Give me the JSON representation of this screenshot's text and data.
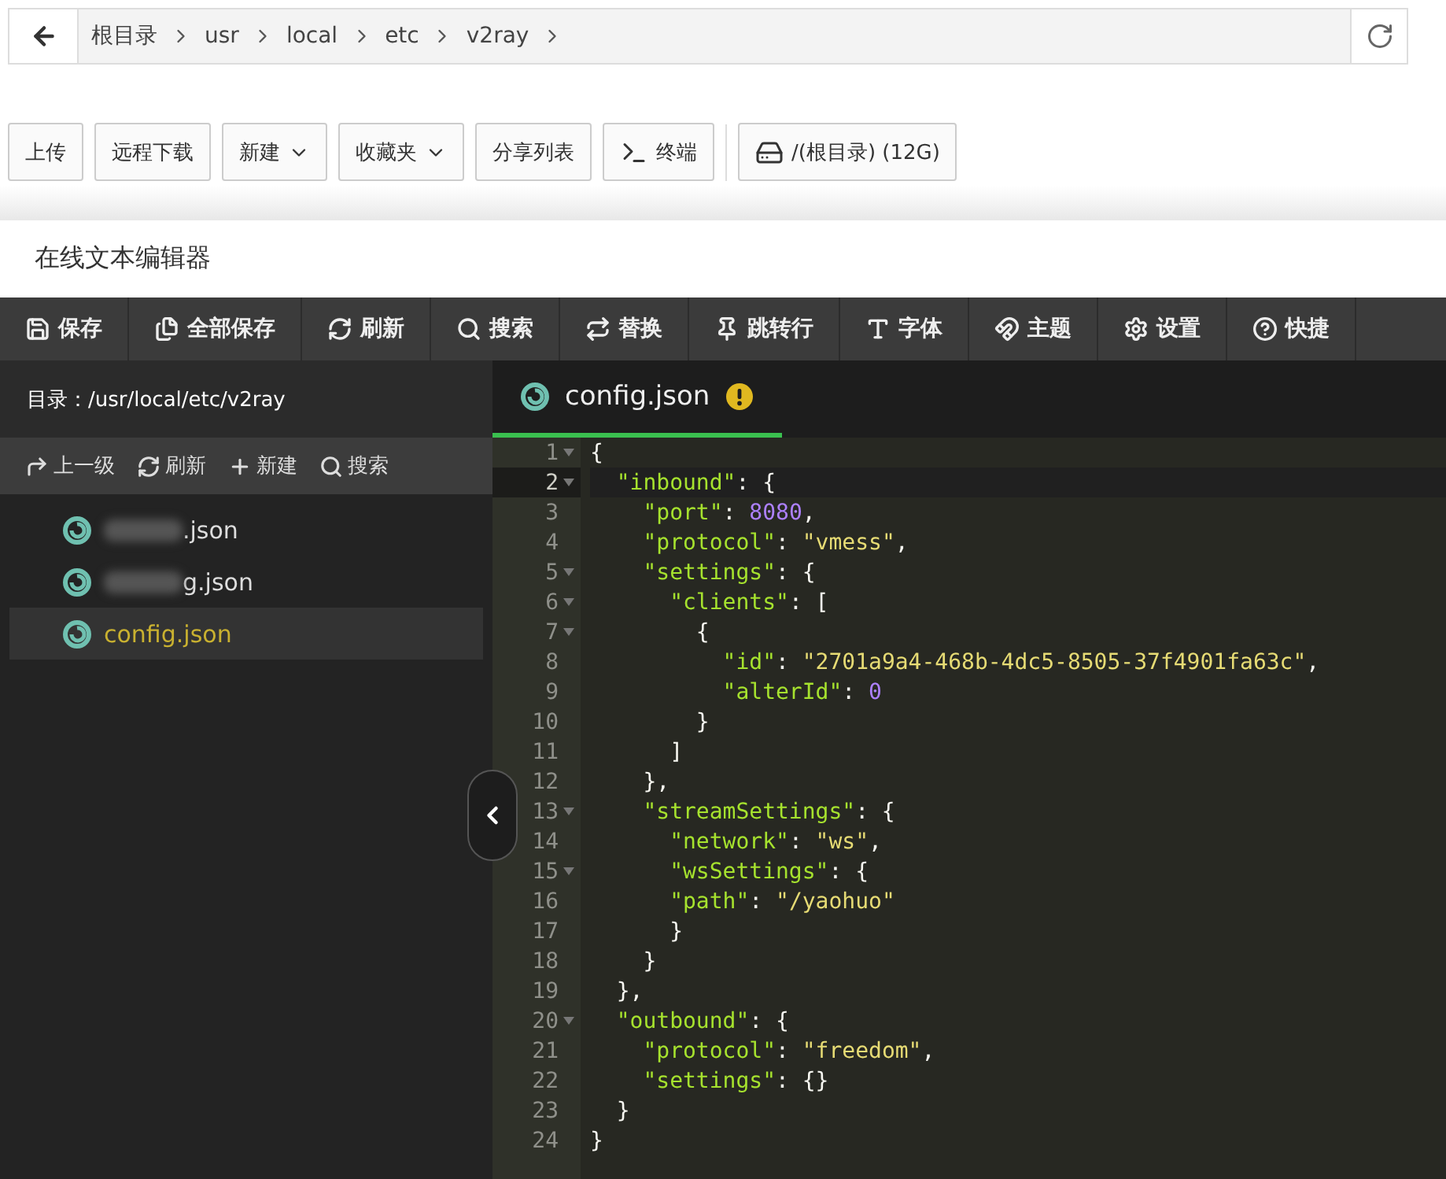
{
  "breadcrumb": {
    "items": [
      "根目录",
      "usr",
      "local",
      "etc",
      "v2ray"
    ]
  },
  "toolbar": [
    {
      "label": "上传",
      "kind": "plain"
    },
    {
      "label": "远程下载",
      "kind": "plain"
    },
    {
      "label": "新建",
      "kind": "dropdown"
    },
    {
      "label": "收藏夹",
      "kind": "dropdown"
    },
    {
      "label": "分享列表",
      "kind": "plain"
    },
    {
      "label": "终端",
      "kind": "terminal"
    },
    {
      "label": "/(根目录) (12G)",
      "kind": "disk"
    }
  ],
  "editor_title": "在线文本编辑器",
  "editor_toolbar": [
    {
      "label": "保存",
      "kind": "save"
    },
    {
      "label": "全部保存",
      "kind": "saveall"
    },
    {
      "label": "刷新",
      "kind": "refresh"
    },
    {
      "label": "搜索",
      "kind": "search"
    },
    {
      "label": "替换",
      "kind": "replace"
    },
    {
      "label": "跳转行",
      "kind": "goto"
    },
    {
      "label": "字体",
      "kind": "font"
    },
    {
      "label": "主题",
      "kind": "theme"
    },
    {
      "label": "设置",
      "kind": "settings"
    },
    {
      "label": "快捷",
      "kind": "help"
    }
  ],
  "sidebar": {
    "path": "目录：/usr/local/etc/v2ray",
    "actions": [
      {
        "label": "上一级",
        "kind": "up"
      },
      {
        "label": "刷新",
        "kind": "refresh"
      },
      {
        "label": "新建",
        "kind": "new"
      },
      {
        "label": "搜索",
        "kind": "search"
      }
    ],
    "files": [
      {
        "name": ".json",
        "redacted": true,
        "selected": false
      },
      {
        "name": "g.json",
        "redacted": true,
        "selected": false
      },
      {
        "name": "config.json",
        "redacted": false,
        "selected": true
      }
    ]
  },
  "tab": {
    "title": "config.json",
    "modified": true
  },
  "lines": [
    {
      "number": "1",
      "foldable": true,
      "active": false,
      "tokens": [
        {
          "kind": "punct",
          "text": "{"
        }
      ]
    },
    {
      "number": "2",
      "foldable": true,
      "active": true,
      "tokens": [
        {
          "kind": "key",
          "text": "  \"inbound\""
        },
        {
          "kind": "punct",
          "text": ": {"
        }
      ]
    },
    {
      "number": "3",
      "foldable": false,
      "active": false,
      "tokens": [
        {
          "kind": "key",
          "text": "    \"port\""
        },
        {
          "kind": "punct",
          "text": ": "
        },
        {
          "kind": "number",
          "text": "8080"
        },
        {
          "kind": "punct",
          "text": ","
        }
      ]
    },
    {
      "number": "4",
      "foldable": false,
      "active": false,
      "tokens": [
        {
          "kind": "key",
          "text": "    \"protocol\""
        },
        {
          "kind": "punct",
          "text": ": "
        },
        {
          "kind": "string",
          "text": "\"vmess\""
        },
        {
          "kind": "punct",
          "text": ","
        }
      ]
    },
    {
      "number": "5",
      "foldable": true,
      "active": false,
      "tokens": [
        {
          "kind": "key",
          "text": "    \"settings\""
        },
        {
          "kind": "punct",
          "text": ": {"
        }
      ]
    },
    {
      "number": "6",
      "foldable": true,
      "active": false,
      "tokens": [
        {
          "kind": "key",
          "text": "      \"clients\""
        },
        {
          "kind": "punct",
          "text": ": ["
        }
      ]
    },
    {
      "number": "7",
      "foldable": true,
      "active": false,
      "tokens": [
        {
          "kind": "punct",
          "text": "        {"
        }
      ]
    },
    {
      "number": "8",
      "foldable": false,
      "active": false,
      "tokens": [
        {
          "kind": "key",
          "text": "          \"id\""
        },
        {
          "kind": "punct",
          "text": ": "
        },
        {
          "kind": "string",
          "text": "\"2701a9a4-468b-4dc5-8505-37f4901fa63c\""
        },
        {
          "kind": "punct",
          "text": ","
        }
      ]
    },
    {
      "number": "9",
      "foldable": false,
      "active": false,
      "tokens": [
        {
          "kind": "key",
          "text": "          \"alterId\""
        },
        {
          "kind": "punct",
          "text": ": "
        },
        {
          "kind": "number",
          "text": "0"
        }
      ]
    },
    {
      "number": "10",
      "foldable": false,
      "active": false,
      "tokens": [
        {
          "kind": "punct",
          "text": "        }"
        }
      ]
    },
    {
      "number": "11",
      "foldable": false,
      "active": false,
      "tokens": [
        {
          "kind": "punct",
          "text": "      ]"
        }
      ]
    },
    {
      "number": "12",
      "foldable": false,
      "active": false,
      "tokens": [
        {
          "kind": "punct",
          "text": "    },"
        }
      ]
    },
    {
      "number": "13",
      "foldable": true,
      "active": false,
      "tokens": [
        {
          "kind": "key",
          "text": "    \"streamSettings\""
        },
        {
          "kind": "punct",
          "text": ": {"
        }
      ]
    },
    {
      "number": "14",
      "foldable": false,
      "active": false,
      "tokens": [
        {
          "kind": "key",
          "text": "      \"network\""
        },
        {
          "kind": "punct",
          "text": ": "
        },
        {
          "kind": "string",
          "text": "\"ws\""
        },
        {
          "kind": "punct",
          "text": ","
        }
      ]
    },
    {
      "number": "15",
      "foldable": true,
      "active": false,
      "tokens": [
        {
          "kind": "key",
          "text": "      \"wsSettings\""
        },
        {
          "kind": "punct",
          "text": ": {"
        }
      ]
    },
    {
      "number": "16",
      "foldable": false,
      "active": false,
      "tokens": [
        {
          "kind": "key",
          "text": "      \"path\""
        },
        {
          "kind": "punct",
          "text": ": "
        },
        {
          "kind": "string",
          "text": "\"/yaohuo\""
        }
      ]
    },
    {
      "number": "17",
      "foldable": false,
      "active": false,
      "tokens": [
        {
          "kind": "punct",
          "text": "      }"
        }
      ]
    },
    {
      "number": "18",
      "foldable": false,
      "active": false,
      "tokens": [
        {
          "kind": "punct",
          "text": "    }"
        }
      ]
    },
    {
      "number": "19",
      "foldable": false,
      "active": false,
      "tokens": [
        {
          "kind": "punct",
          "text": "  },"
        }
      ]
    },
    {
      "number": "20",
      "foldable": true,
      "active": false,
      "tokens": [
        {
          "kind": "key",
          "text": "  \"outbound\""
        },
        {
          "kind": "punct",
          "text": ": {"
        }
      ]
    },
    {
      "number": "21",
      "foldable": false,
      "active": false,
      "tokens": [
        {
          "kind": "key",
          "text": "    \"protocol\""
        },
        {
          "kind": "punct",
          "text": ": "
        },
        {
          "kind": "string",
          "text": "\"freedom\""
        },
        {
          "kind": "punct",
          "text": ","
        }
      ]
    },
    {
      "number": "22",
      "foldable": false,
      "active": false,
      "tokens": [
        {
          "kind": "key",
          "text": "    \"settings\""
        },
        {
          "kind": "punct",
          "text": ": {}"
        }
      ]
    },
    {
      "number": "23",
      "foldable": false,
      "active": false,
      "tokens": [
        {
          "kind": "punct",
          "text": "  }"
        }
      ]
    },
    {
      "number": "24",
      "foldable": false,
      "active": false,
      "tokens": [
        {
          "kind": "punct",
          "text": "}"
        }
      ]
    }
  ]
}
